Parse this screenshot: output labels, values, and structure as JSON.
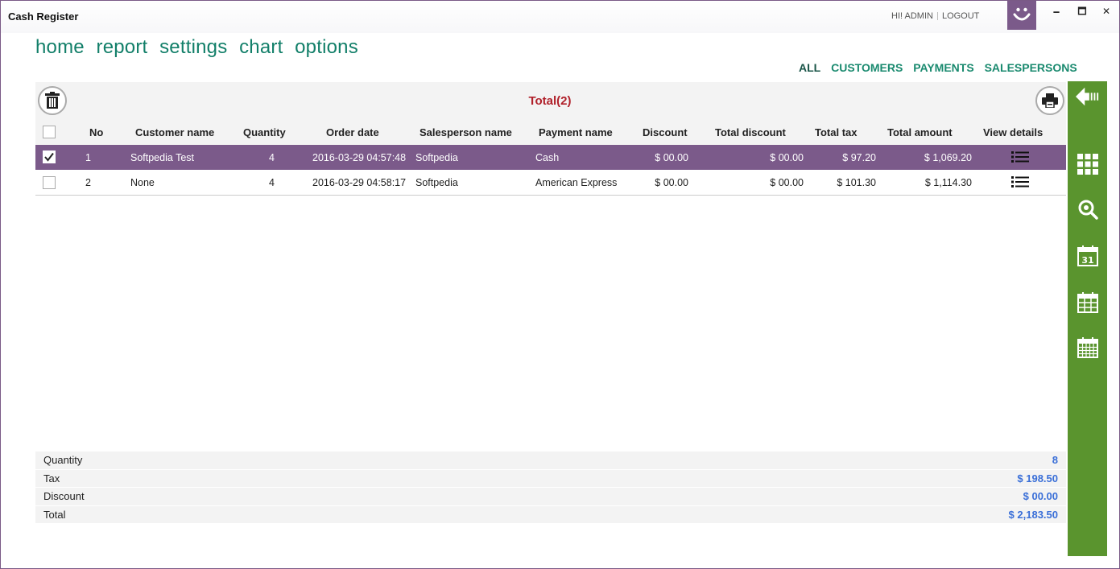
{
  "window": {
    "title": "Cash Register",
    "minimize": "🗕",
    "maximize": "🗖",
    "close": "✕"
  },
  "user": {
    "greeting": "HI! ADMIN",
    "logout": "LOGOUT"
  },
  "main_nav": [
    "home",
    "report",
    "settings",
    "chart",
    "options"
  ],
  "filter_nav": [
    "ALL",
    "CUSTOMERS",
    "PAYMENTS",
    "SALESPERSONS"
  ],
  "active_filter": "ALL",
  "table": {
    "total_label": "Total(2)",
    "columns": [
      "No",
      "Customer name",
      "Quantity",
      "Order date",
      "Salesperson name",
      "Payment name",
      "Discount",
      "Total discount",
      "Total tax",
      "Total amount",
      "View details"
    ],
    "rows": [
      {
        "checked": true,
        "no": "1",
        "customer": "Softpedia Test",
        "quantity": "4",
        "order_date": "2016-03-29 04:57:48",
        "salesperson": "Softpedia",
        "payment": "Cash",
        "discount": "$ 00.00",
        "total_discount": "$ 00.00",
        "total_tax": "$ 97.20",
        "total_amount": "$ 1,069.20"
      },
      {
        "checked": false,
        "no": "2",
        "customer": "None",
        "quantity": "4",
        "order_date": "2016-03-29 04:58:17",
        "salesperson": "Softpedia",
        "payment": "American Express",
        "discount": "$ 00.00",
        "total_discount": "$ 00.00",
        "total_tax": "$ 101.30",
        "total_amount": "$ 1,114.30"
      }
    ]
  },
  "summary": [
    {
      "label": "Quantity",
      "value": "8"
    },
    {
      "label": "Tax",
      "value": "$ 198.50"
    },
    {
      "label": "Discount",
      "value": "$ 00.00"
    },
    {
      "label": "Total",
      "value": "$ 2,183.50"
    }
  ],
  "sidebar": {
    "icons": [
      "back-arrow-icon",
      "grid-icon",
      "search-refresh-icon",
      "calendar-day-icon",
      "calendar-month-icon",
      "calendar-year-icon"
    ],
    "calendar_day_number": "31"
  },
  "colors": {
    "accent_purple": "#7b5a8a",
    "nav_green": "#127f69",
    "sidebar_green": "#5a942e",
    "total_red": "#b0202a",
    "summary_blue": "#3a6fd8"
  }
}
